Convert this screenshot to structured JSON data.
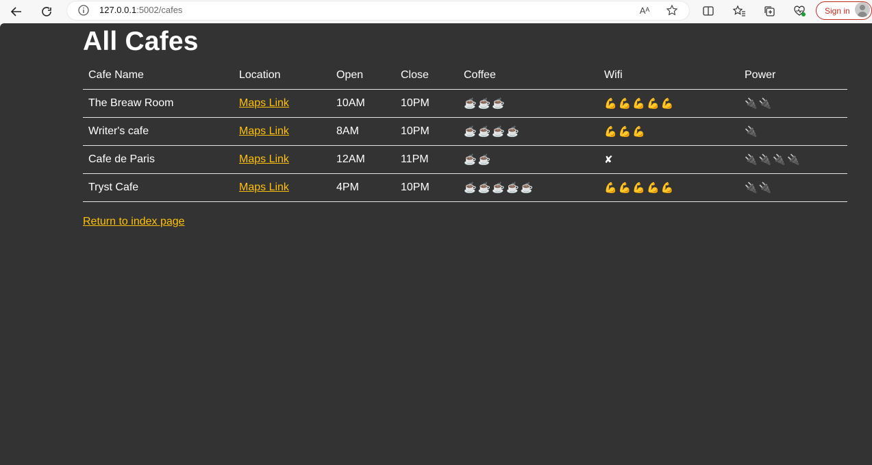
{
  "browser": {
    "url_host": "127.0.0.1",
    "url_path": ":5002/cafes",
    "read_aloud": "Aᴬ",
    "sign_in": "Sign in"
  },
  "page": {
    "title": "All Cafes",
    "return_link": "Return to index page"
  },
  "table": {
    "headers": [
      "Cafe Name",
      "Location",
      "Open",
      "Close",
      "Coffee",
      "Wifi",
      "Power"
    ],
    "rows": [
      {
        "name": "The Breaw Room",
        "location": "Maps Link",
        "open": "10AM",
        "close": "10PM",
        "coffee": "☕☕☕",
        "wifi": "💪💪💪💪💪",
        "power": "🔌🔌"
      },
      {
        "name": "Writer's cafe",
        "location": "Maps Link",
        "open": "8AM",
        "close": "10PM",
        "coffee": "☕☕☕☕",
        "wifi": "💪💪💪",
        "power": "🔌"
      },
      {
        "name": "Cafe de Paris",
        "location": "Maps Link",
        "open": "12AM",
        "close": "11PM",
        "coffee": "☕☕",
        "wifi": "✘",
        "power": "🔌🔌🔌🔌"
      },
      {
        "name": "Tryst Cafe",
        "location": "Maps Link",
        "open": "4PM",
        "close": "10PM",
        "coffee": "☕☕☕☕☕",
        "wifi": "💪💪💪💪💪",
        "power": "🔌🔌"
      }
    ]
  },
  "colors": {
    "page_bg": "#333333",
    "link": "#ffc107",
    "text": "#ffffff",
    "sign_in_accent": "#c42b1c"
  }
}
